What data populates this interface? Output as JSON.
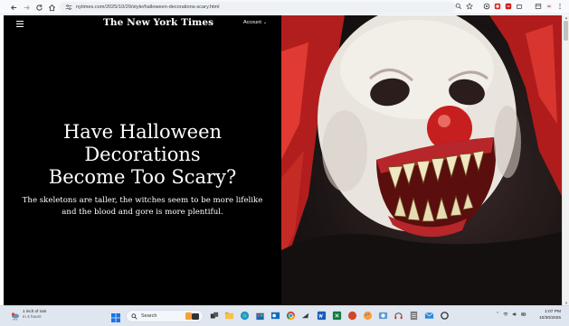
{
  "browser": {
    "url": "nytimes.com/2025/10/29/style/halloween-decorations-scary.html"
  },
  "site": {
    "logo": "The New York Times",
    "account_label": "Account"
  },
  "article": {
    "headline_lines": [
      "Have Halloween",
      "Decorations",
      "Become Too Scary?"
    ],
    "dek": "The skeletons are taller, the witches seem to be more lifelike and the blood and gore is more plentiful."
  },
  "taskbar": {
    "weather_line1": "1 inch of rain",
    "weather_line2": "In 4 hours",
    "search_placeholder": "Search",
    "time": "1:07 PM",
    "date": "10/30/2025"
  },
  "colors": {
    "page_bg": "#000000",
    "text": "#ffffff",
    "clown_red": "#d9302a",
    "taskbar_bg": "#dfe6ef"
  }
}
